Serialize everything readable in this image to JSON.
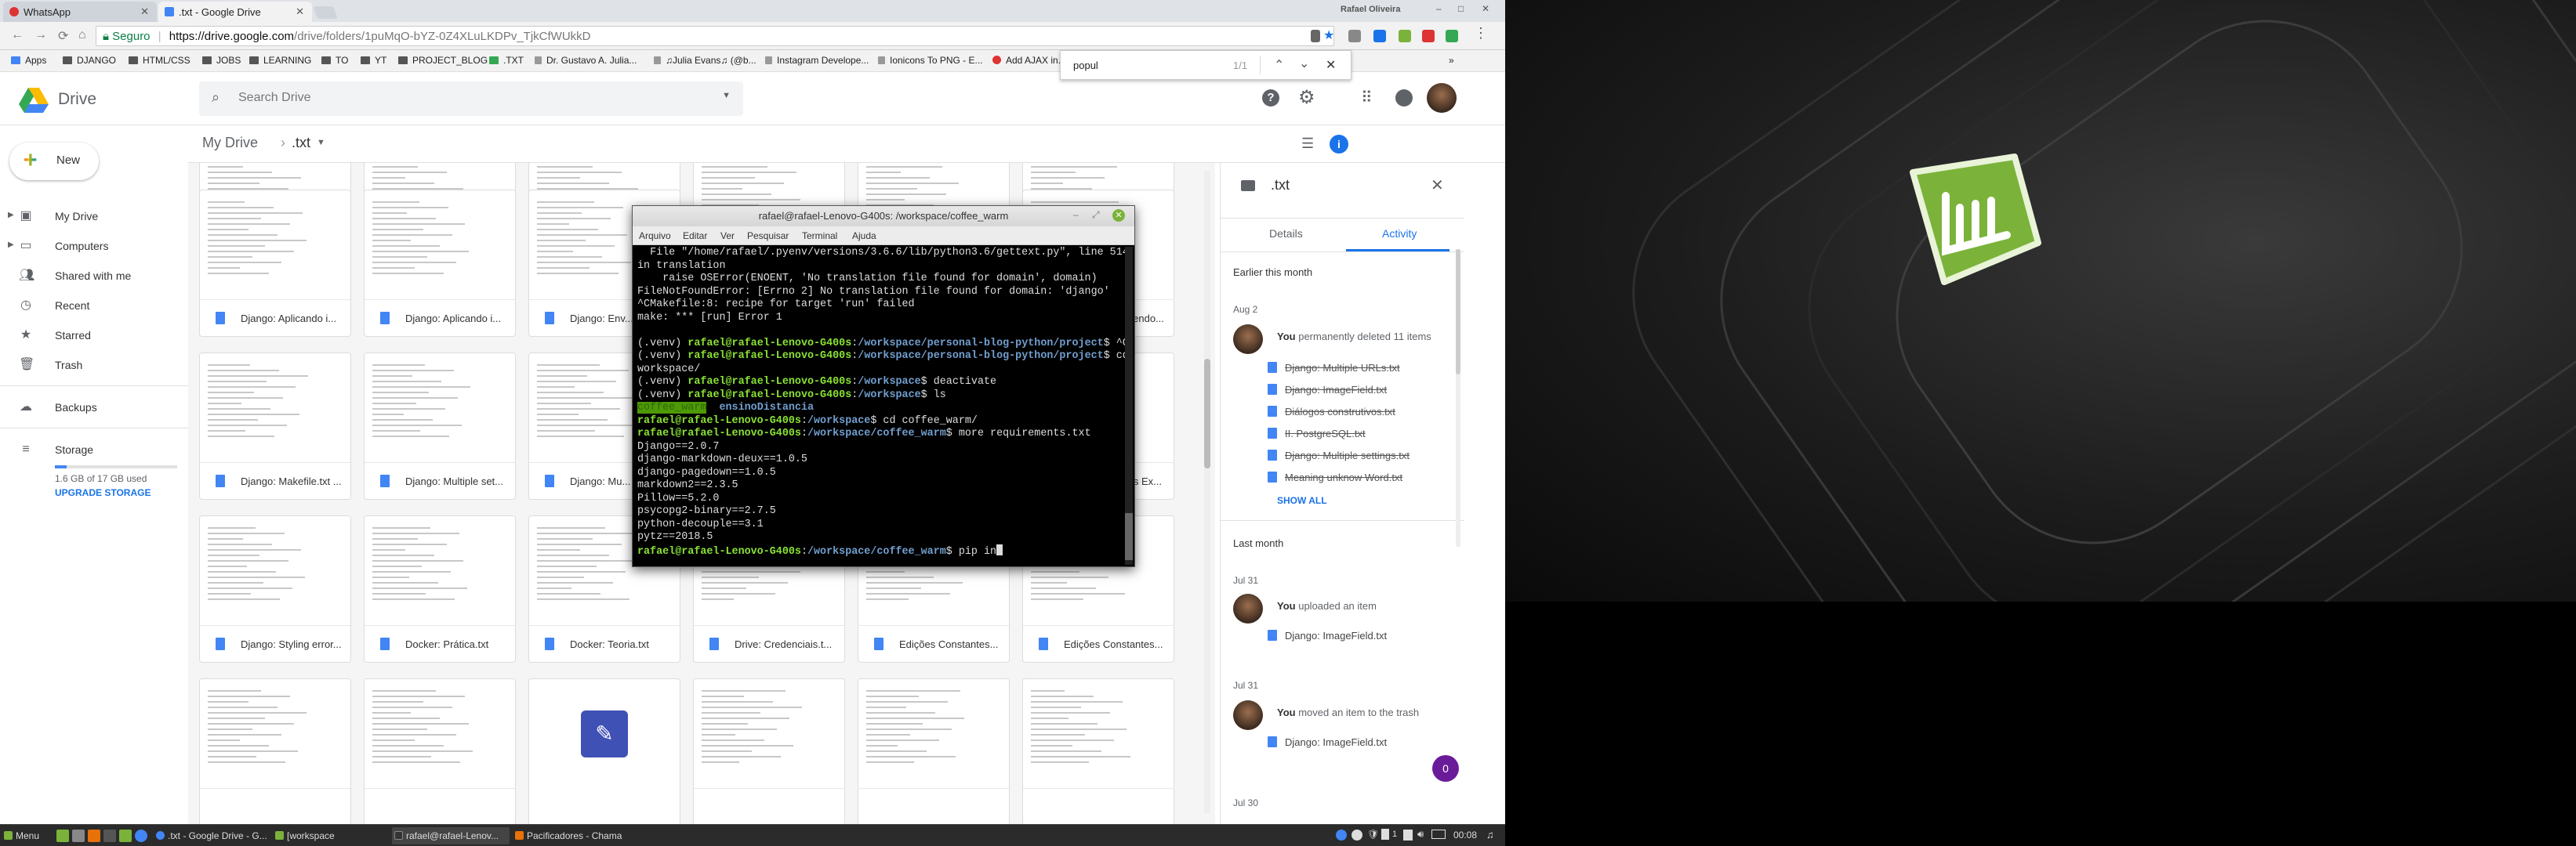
{
  "browser": {
    "tabs": [
      {
        "label": "WhatsApp",
        "color": "#d33"
      },
      {
        "label": ".txt - Google Drive",
        "color": "#4285f4"
      }
    ],
    "profile_label": "Rafael Oliveira",
    "url": {
      "secure_label": "Seguro",
      "host": "https://drive.google.com",
      "path": "/drive/folders/1puMqO-bYZ-0Z4XLuLKDPv_TjkCfWUkkD"
    },
    "bookmarks": [
      "Apps",
      "DJANGO",
      "HTML/CSS",
      "JOBS",
      "LEARNING",
      "TO",
      "YT",
      "PROJECT_BLOG",
      ".TXT",
      "Dr. Gustavo A. Julia...",
      "♫Julia Evans♫ (@b...",
      "Instagram Develope...",
      "Ionicons To PNG - E...",
      "Add AJAX in..."
    ],
    "more_bookmarks": "»",
    "find": {
      "query": "popul",
      "count": "1/1"
    }
  },
  "drive": {
    "brand": "Drive",
    "search_placeholder": "Search Drive",
    "breadcrumb": {
      "root": "My Drive",
      "current": ".txt"
    },
    "new_label": "New",
    "sidebar": [
      {
        "label": "My Drive",
        "icon": "drive-icon"
      },
      {
        "label": "Computers",
        "icon": "computer-icon"
      },
      {
        "label": "Shared with me",
        "icon": "people-icon"
      },
      {
        "label": "Recent",
        "icon": "clock-icon"
      },
      {
        "label": "Starred",
        "icon": "star-icon"
      },
      {
        "label": "Trash",
        "icon": "trash-icon"
      },
      {
        "label": "Backups",
        "icon": "cloud-icon"
      },
      {
        "label": "Storage",
        "icon": "storage-icon"
      }
    ],
    "storage": {
      "used_text": "1.6 GB of 17 GB used",
      "used_fraction": 0.094,
      "upgrade_label": "UPGRADE STORAGE"
    },
    "files": [
      {
        "name": "Django: Aplicando i..."
      },
      {
        "name": "Django: Aplicando i..."
      },
      {
        "name": "Django: Env..."
      },
      {
        "name": "Django: Escrevendo..."
      },
      {
        "name": "Django: Makefile.txt ..."
      },
      {
        "name": "Django: Multiple set..."
      },
      {
        "name": "Django: Mu..."
      },
      {
        "name": "Django: Settings Ex..."
      },
      {
        "name": "Django: Styling error..."
      },
      {
        "name": "Docker: Prática.txt"
      },
      {
        "name": "Docker: Teoria.txt"
      },
      {
        "name": "Drive: Credenciais.t..."
      },
      {
        "name": "Edições Constantes..."
      },
      {
        "name": "Edições Constantes..."
      }
    ],
    "details": {
      "title": ".txt",
      "tabs": [
        "Details",
        "Activity"
      ],
      "active_tab": "Activity",
      "sections": [
        {
          "heading": "Earlier this month"
        },
        {
          "heading": "Last month"
        }
      ],
      "activities": [
        {
          "date": "Aug 2",
          "actor": "You",
          "action": "permanently deleted 11 items",
          "items": [
            "Django: Multiple URLs.txt",
            "Django: ImageField.txt",
            "Diálogos construtivos.txt",
            "II. PostgreSQL.txt",
            "Django: Multiple settings.txt",
            "Meaning unknow Word.txt"
          ],
          "show_all": "SHOW ALL"
        },
        {
          "date": "Jul 31",
          "actor": "You",
          "action": "uploaded an item",
          "items": [
            "Django: ImageField.txt"
          ]
        },
        {
          "date": "Jul 31",
          "actor": "You",
          "action": "moved an item to the trash",
          "items": [
            "Django: ImageField.txt"
          ]
        },
        {
          "date": "Jul 30"
        }
      ],
      "badge": "0"
    }
  },
  "terminal": {
    "title": "rafael@rafael-Lenovo-G400s: /workspace/coffee_warm",
    "menu": [
      "Arquivo",
      "Editar",
      "Ver",
      "Pesquisar",
      "Terminal",
      "Ajuda"
    ],
    "lines": [
      "  File \"/home/rafael/.pyenv/versions/3.6.6/lib/python3.6/gettext.py\", line 514,",
      "in translation",
      "    raise OSError(ENOENT, 'No translation file found for domain', domain)",
      "FileNotFoundError: [Errno 2] No translation file found for domain: 'django'",
      "^CMakefile:8: recipe for target 'run' failed",
      "make: *** [run] Error 1",
      "",
      "(.venv) rafael@rafael-Lenovo-G400s:/workspace/personal-blog-python/project$ ^C",
      "(.venv) rafael@rafael-Lenovo-G400s:/workspace/personal-blog-python/project$ cd /",
      "workspace/",
      "(.venv) rafael@rafael-Lenovo-G400s:/workspace$ deactivate",
      "(.venv) rafael@rafael-Lenovo-G400s:/workspace$ ls",
      "coffee_warm  ensinoDistancia",
      "rafael@rafael-Lenovo-G400s:/workspace$ cd coffee_warm/",
      "rafael@rafael-Lenovo-G400s:/workspace/coffee_warm$ more requirements.txt",
      "Django==2.0.7",
      "django-markdown-deux==1.0.5",
      "django-pagedown==1.0.5",
      "markdown2==2.3.5",
      "Pillow==5.2.0",
      "psycopg2-binary==2.7.5",
      "python-decouple==3.1",
      "pytz==2018.5",
      "rafael@rafael-Lenovo-G400s:/workspace/coffee_warm$ pip in"
    ]
  },
  "taskbar": {
    "menu_label": "Menu",
    "tasks": [
      ".txt - Google Drive - G...",
      "[workspace",
      "rafael@rafael-Lenov...",
      "Pacificadores - Chama"
    ],
    "time": "00:08",
    "tray_count": "1"
  }
}
